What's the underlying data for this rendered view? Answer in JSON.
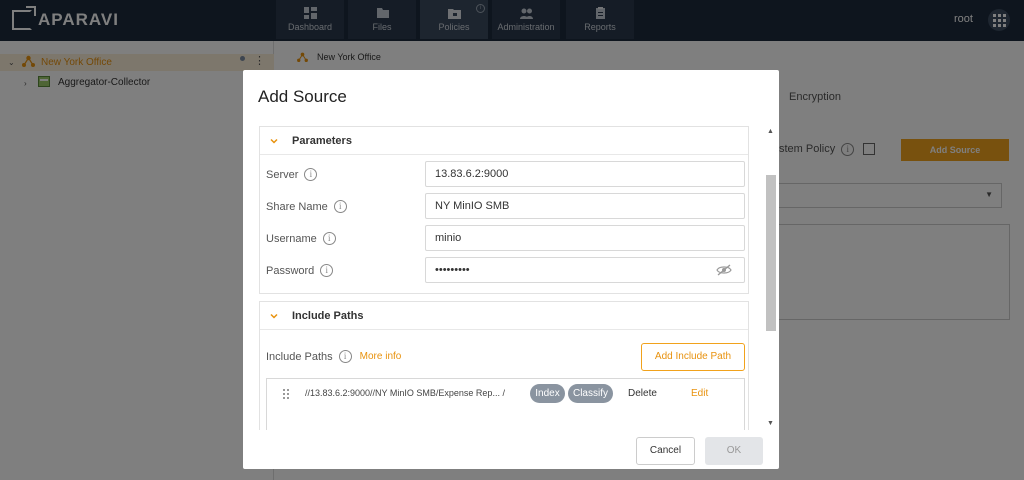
{
  "app": {
    "logo": "APARAVI",
    "user": "root"
  },
  "nav": {
    "tabs": [
      {
        "label": "Dashboard",
        "icon": "dashboard-icon"
      },
      {
        "label": "Files",
        "icon": "folder-icon"
      },
      {
        "label": "Policies",
        "icon": "policies-icon",
        "active": true
      },
      {
        "label": "Administration",
        "icon": "users-icon"
      },
      {
        "label": "Reports",
        "icon": "clipboard-icon"
      }
    ],
    "info_glyph": "i"
  },
  "tree": {
    "items": [
      {
        "label": "New York Office",
        "icon": "network-icon",
        "selected": true
      },
      {
        "label": "Aggregator-Collector",
        "icon": "server-icon"
      }
    ]
  },
  "background": {
    "breadcrumb": "New York Office",
    "tab_encryption": "Encryption",
    "system_policy_label": "stem Policy",
    "add_source_label": "Add Source"
  },
  "modal": {
    "title": "Add Source",
    "parameters": {
      "title": "Parameters",
      "fields": [
        {
          "label": "Server",
          "value": "13.83.6.2:9000"
        },
        {
          "label": "Share Name",
          "value": "NY MinIO SMB"
        },
        {
          "label": "Username",
          "value": "minio"
        },
        {
          "label": "Password",
          "value": "•••••••••"
        }
      ]
    },
    "include_paths": {
      "title": "Include Paths",
      "label": "Include Paths",
      "more_info": "More info",
      "add_button": "Add Include Path",
      "rows": [
        {
          "path": "//13.83.6.2:9000//NY MinIO SMB/Expense Rep... /",
          "chips": [
            "Index",
            "Classify"
          ],
          "delete": "Delete",
          "edit": "Edit"
        }
      ]
    },
    "cancel_label": "Cancel",
    "ok_label": "OK"
  },
  "colors": {
    "accent": "#f1a21c",
    "nav_bg": "#1c2a3c",
    "chip_bg": "#8a94a0"
  }
}
